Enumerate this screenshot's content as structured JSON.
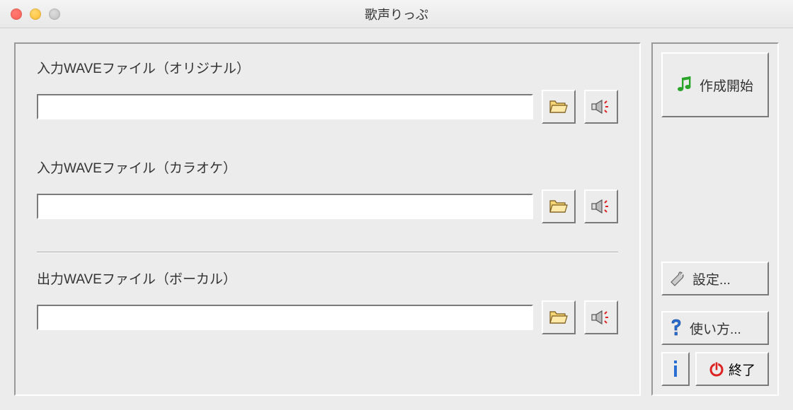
{
  "window": {
    "title": "歌声りっぷ"
  },
  "sections": {
    "input_original": {
      "label": "入力WAVEファイル（オリジナル）",
      "value": ""
    },
    "input_karaoke": {
      "label": "入力WAVEファイル（カラオケ）",
      "value": ""
    },
    "output_vocal": {
      "label": "出力WAVEファイル（ボーカル）",
      "value": ""
    }
  },
  "buttons": {
    "start": "作成開始",
    "settings": "設定...",
    "help": "使い方...",
    "exit": "終了"
  },
  "icons": {
    "folder": "folder-open-icon",
    "speaker": "speaker-icon",
    "music": "music-note-icon",
    "wrench": "wrench-icon",
    "question": "question-icon",
    "info": "info-icon",
    "power": "power-icon"
  }
}
